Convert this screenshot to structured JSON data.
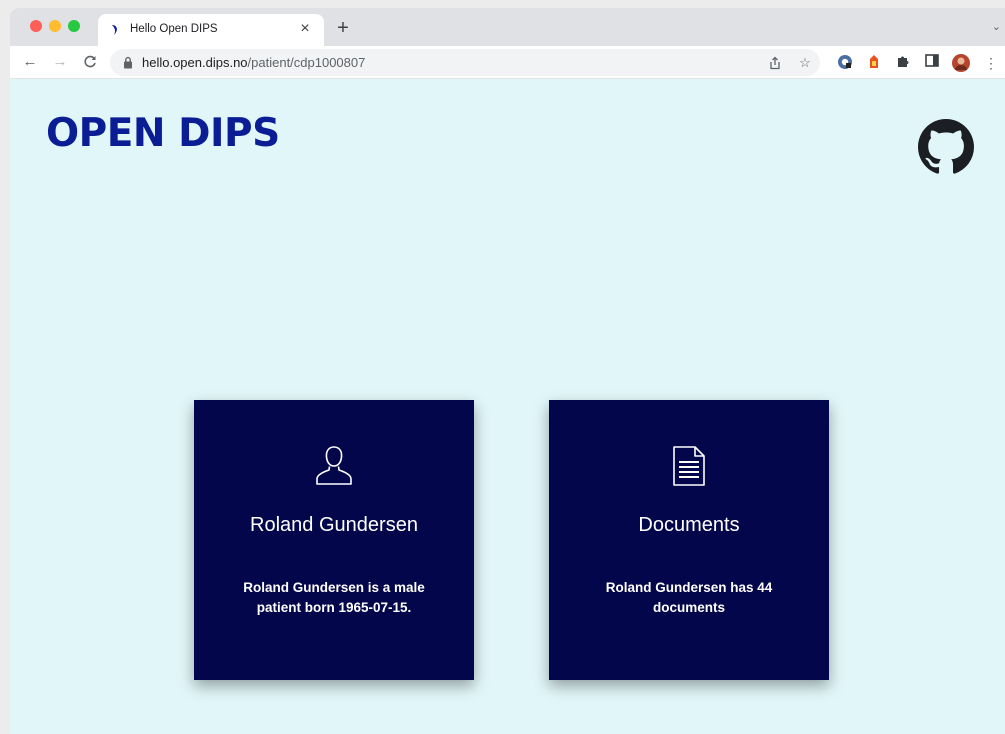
{
  "browser": {
    "tab_title": "Hello Open DIPS",
    "tab_close": "×",
    "new_tab": "+",
    "tab_menu": "⌄",
    "url_host": "hello.open.dips.no",
    "url_path": "/patient/cdp1000807",
    "nav": {
      "back": "←",
      "forward": "→",
      "reload": "C"
    }
  },
  "page": {
    "logo": "OPEN DIPS",
    "cards": [
      {
        "title": "Roland Gundersen",
        "description": "Roland Gundersen is a male patient born 1965-07-15.",
        "icon": "user-icon"
      },
      {
        "title": "Documents",
        "description": "Roland Gundersen has 44 documents",
        "icon": "document-icon"
      }
    ]
  },
  "colors": {
    "logo": "#0a1d94",
    "card_bg": "#03064a",
    "page_bg": "#e0f6f8"
  }
}
